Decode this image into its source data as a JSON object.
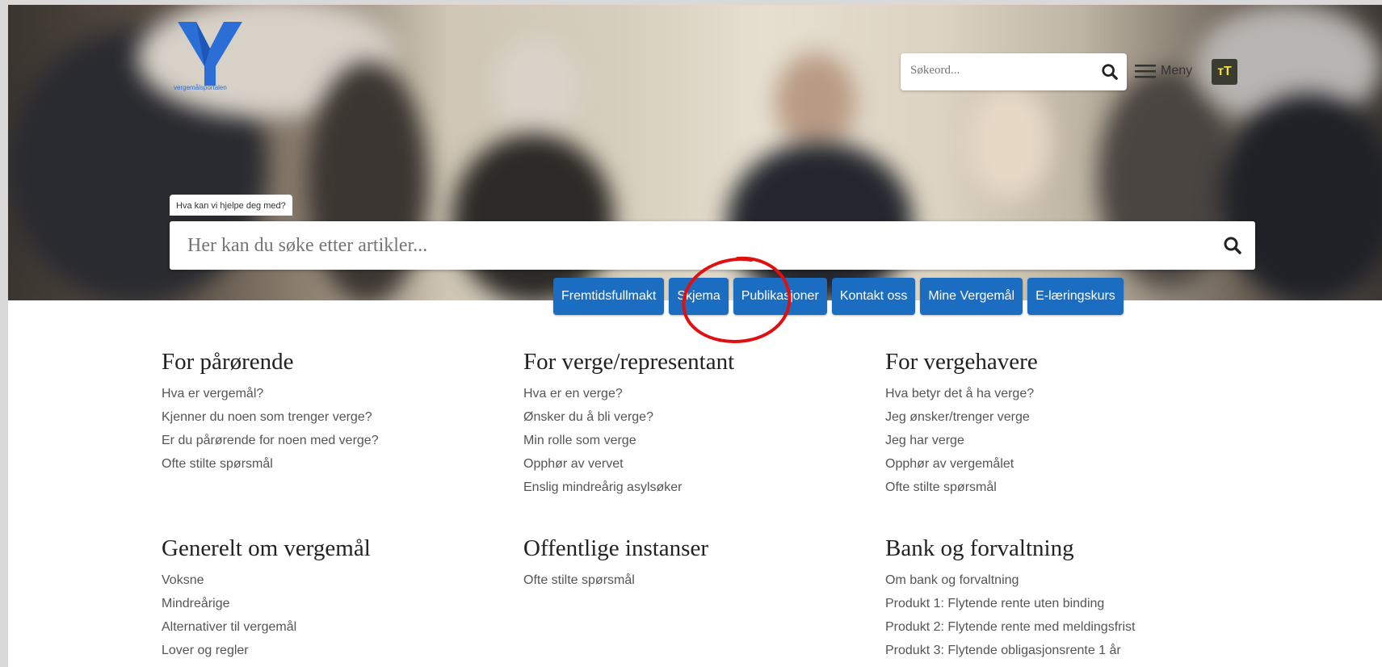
{
  "header": {
    "logo_icon": "y-logo-icon",
    "logo_text": "vergemålsportalen",
    "search_placeholder": "Søkeord...",
    "menu_label": "Meny",
    "text_size_label": "тT"
  },
  "hero": {
    "help_label": "Hva kan vi hjelpe deg med?",
    "search_placeholder": "Her kan du søke etter artikler..."
  },
  "quick_links": [
    "Fremtidsfullmakt",
    "Skjema",
    "Publikasjoner",
    "Kontakt oss",
    "Mine Vergemål",
    "E-læringskurs"
  ],
  "sections": [
    {
      "title": "For pårørende",
      "links": [
        "Hva er vergemål?",
        "Kjenner du noen som trenger verge?",
        "Er du pårørende for noen med verge?",
        "Ofte stilte spørsmål"
      ]
    },
    {
      "title": "For verge/representant",
      "links": [
        "Hva er en verge?",
        "Ønsker du å bli verge?",
        "Min rolle som verge",
        "Opphør av vervet",
        "Enslig mindreårig asylsøker"
      ]
    },
    {
      "title": "For vergehavere",
      "links": [
        "Hva betyr det å ha verge?",
        "Jeg ønsker/trenger verge",
        "Jeg har verge",
        "Opphør av vergemålet",
        "Ofte stilte spørsmål"
      ]
    },
    {
      "title": "Generelt om vergemål",
      "links": [
        "Voksne",
        "Mindreårige",
        "Alternativer til vergemål",
        "Lover og regler"
      ]
    },
    {
      "title": "Offentlige instanser",
      "links": [
        "Ofte stilte spørsmål"
      ]
    },
    {
      "title": "Bank og forvaltning",
      "links": [
        "Om bank og forvaltning",
        "Produkt 1: Flytende rente uten binding",
        "Produkt 2: Flytende rente med meldingsfrist",
        "Produkt 3: Flytende obligasjonsrente 1 år"
      ]
    }
  ],
  "colors": {
    "button_blue": "#1b6dc2",
    "logo_blue": "#2b6fd6",
    "annotation_red": "#e01010"
  }
}
